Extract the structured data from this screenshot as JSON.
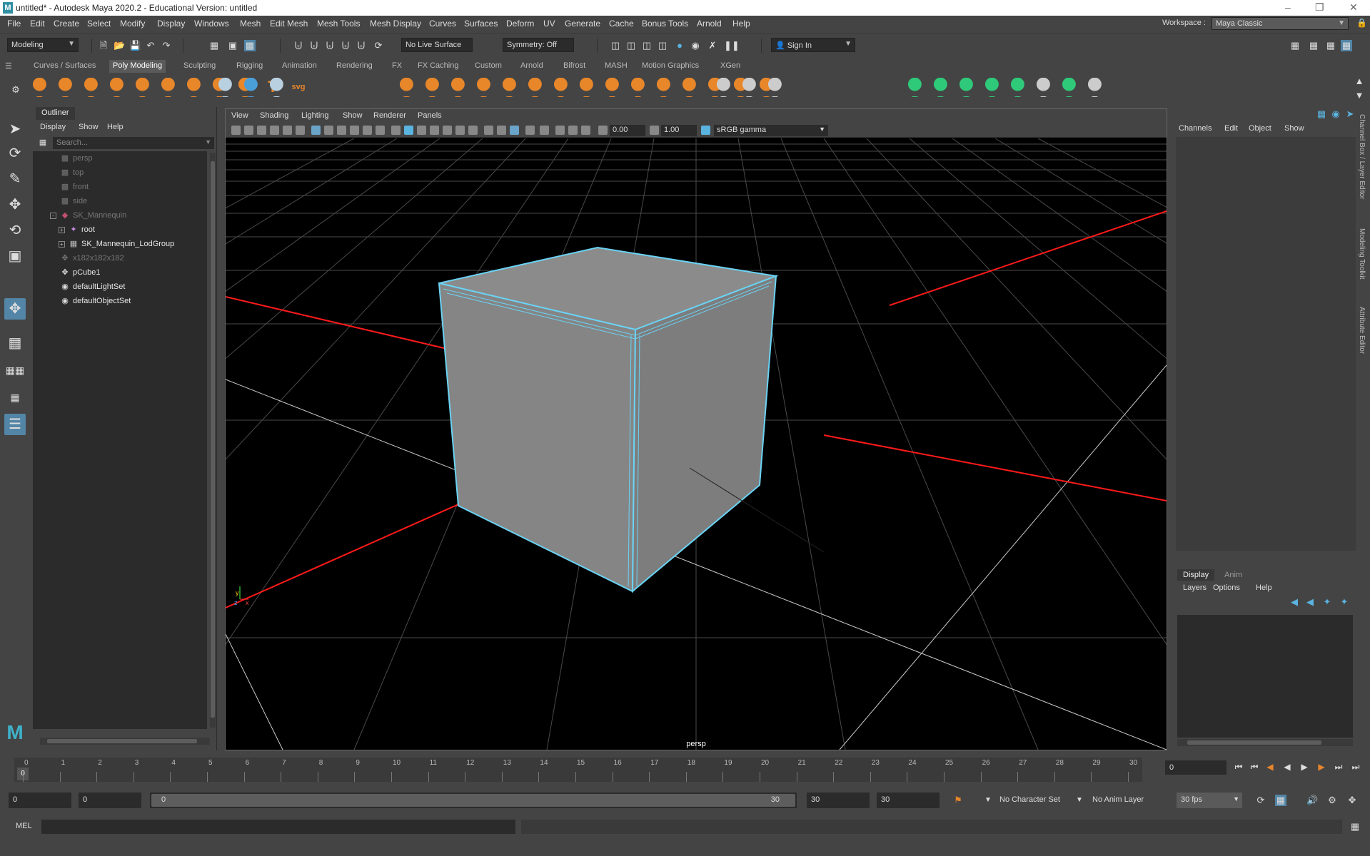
{
  "window": {
    "title": "untitled* - Autodesk Maya 2020.2 - Educational Version: untitled",
    "logo": "M"
  },
  "menubar": {
    "items": [
      "File",
      "Edit",
      "Create",
      "Select",
      "Modify",
      "Display",
      "Windows",
      "Mesh",
      "Edit Mesh",
      "Mesh Tools",
      "Mesh Display",
      "Curves",
      "Surfaces",
      "Deform",
      "UV",
      "Generate",
      "Cache",
      "Bonus Tools",
      "Arnold",
      "Help"
    ],
    "workspace_label": "Workspace :",
    "workspace_value": "Maya Classic"
  },
  "statusline": {
    "mode": "Modeling",
    "live_surface": "No Live Surface",
    "symmetry": "Symmetry: Off",
    "sign_in": "Sign In"
  },
  "shelf": {
    "tabs": [
      "Curves / Surfaces",
      "Poly Modeling",
      "Sculpting",
      "Rigging",
      "Animation",
      "Rendering",
      "FX",
      "FX Caching",
      "Custom",
      "Arnold",
      "Bifrost",
      "MASH",
      "Motion Graphics",
      "XGen"
    ],
    "active": "Poly Modeling",
    "icons": [
      {
        "name": "poly-sphere-icon",
        "color": "#e8862a"
      },
      {
        "name": "poly-cube-icon",
        "color": "#e8862a"
      },
      {
        "name": "poly-cylinder-icon",
        "color": "#e8862a"
      },
      {
        "name": "poly-cone-icon",
        "color": "#e8862a"
      },
      {
        "name": "poly-torus-icon",
        "color": "#e8862a"
      },
      {
        "name": "poly-plane-icon",
        "color": "#e8862a"
      },
      {
        "name": "poly-disc-icon",
        "color": "#e8862a"
      },
      {
        "name": "platonic-icon",
        "color": "#e8862a"
      },
      {
        "name": "super-shape-icon",
        "color": "#e8862a"
      },
      {
        "name": "type-icon",
        "color": "#e8862a",
        "glyph": "T"
      },
      {
        "name": "svg-icon",
        "color": "#e8862a",
        "glyph": "svg"
      },
      {
        "name": "combine-icon",
        "color": "#b8d0e0"
      },
      {
        "name": "separate-icon",
        "color": "#4a9fd8"
      },
      {
        "name": "smooth-icon",
        "color": "#b8d0e0"
      },
      {
        "name": "extract-icon",
        "color": "#e8862a"
      },
      {
        "name": "boolean-icon",
        "color": "#e8862a"
      },
      {
        "name": "mirror-icon",
        "color": "#e8862a"
      },
      {
        "name": "smooth-mesh-icon",
        "color": "#e8862a"
      },
      {
        "name": "reduce-icon",
        "color": "#e8862a"
      },
      {
        "name": "remesh-icon",
        "color": "#e8862a"
      },
      {
        "name": "retopo-icon",
        "color": "#e8862a"
      },
      {
        "name": "extrude-icon",
        "color": "#e8862a"
      },
      {
        "name": "bridge-icon",
        "color": "#e8862a"
      },
      {
        "name": "bevel-icon",
        "color": "#e8862a"
      },
      {
        "name": "fill-hole-icon",
        "color": "#e8862a"
      },
      {
        "name": "append-icon",
        "color": "#e8862a"
      },
      {
        "name": "wedge-icon",
        "color": "#e8862a"
      },
      {
        "name": "poke-icon",
        "color": "#e8862a"
      },
      {
        "name": "circularize-icon",
        "color": "#e8862a"
      },
      {
        "name": "multi-cut-icon",
        "color": "#cccccc"
      },
      {
        "name": "edge-loop-icon",
        "color": "#cccccc"
      },
      {
        "name": "slide-icon",
        "color": "#cccccc"
      },
      {
        "name": "uv-project-icon",
        "color": "#2fc97a"
      },
      {
        "name": "uv-camera-icon",
        "color": "#2fc97a"
      },
      {
        "name": "uv-auto-icon",
        "color": "#2fc97a"
      },
      {
        "name": "uv-cylindrical-icon",
        "color": "#2fc97a"
      },
      {
        "name": "uv-unfold-icon",
        "color": "#2fc97a"
      },
      {
        "name": "uv-layout-icon",
        "color": "#cccccc"
      },
      {
        "name": "uv-cut-icon",
        "color": "#2fc97a"
      },
      {
        "name": "uv-sew-icon",
        "color": "#cccccc"
      }
    ]
  },
  "outliner": {
    "title": "Outliner",
    "menu": [
      "Display",
      "Show",
      "Help"
    ],
    "search_placeholder": "Search...",
    "rows": [
      {
        "label": "persp",
        "icon": "camera-icon",
        "level": 1,
        "dim": true
      },
      {
        "label": "top",
        "icon": "camera-icon",
        "level": 1,
        "dim": true
      },
      {
        "label": "front",
        "icon": "camera-icon",
        "level": 1,
        "dim": true
      },
      {
        "label": "side",
        "icon": "camera-icon",
        "level": 1,
        "dim": true
      },
      {
        "label": "SK_Mannequin",
        "icon": "mesh-icon",
        "level": 1,
        "dim": true,
        "expander": "-"
      },
      {
        "label": "root",
        "icon": "joint-icon",
        "level": 2,
        "dim": false,
        "expander": "+"
      },
      {
        "label": "SK_Mannequin_LodGroup",
        "icon": "lod-icon",
        "level": 2,
        "dim": false,
        "expander": "+"
      },
      {
        "label": "x182x182x182",
        "icon": "transform-icon",
        "level": 1,
        "dim": true
      },
      {
        "label": "pCube1",
        "icon": "transform-icon",
        "level": 1,
        "dim": false
      },
      {
        "label": "defaultLightSet",
        "icon": "set-icon",
        "level": 1,
        "dim": false
      },
      {
        "label": "defaultObjectSet",
        "icon": "set-icon",
        "level": 1,
        "dim": false
      }
    ]
  },
  "viewport": {
    "menu": [
      "View",
      "Shading",
      "Lighting",
      "Show",
      "Renderer",
      "Panels"
    ],
    "exposure": "0.00",
    "gamma": "1.00",
    "color_space": "sRGB gamma",
    "camera_label": "persp",
    "axis_x": "x",
    "axis_y": "y",
    "axis_z": "z"
  },
  "channelbox": {
    "menu": [
      "Channels",
      "Edit",
      "Object",
      "Show"
    ],
    "tabs": [
      "Display",
      "Anim"
    ],
    "active_tab": "Display",
    "layer_menu": [
      "Layers",
      "Options",
      "Help"
    ]
  },
  "side_tabs": [
    "Channel Box / Layer Editor",
    "Modeling Toolkit",
    "Attribute Editor"
  ],
  "timeline": {
    "ticks": [
      0,
      1,
      2,
      3,
      4,
      5,
      6,
      7,
      8,
      9,
      10,
      11,
      12,
      13,
      14,
      15,
      16,
      17,
      18,
      19,
      20,
      21,
      22,
      23,
      24,
      25,
      26,
      27,
      28,
      29,
      30
    ],
    "current": "0",
    "current_frame_field": "0"
  },
  "range": {
    "start": "0",
    "anim_start": "0",
    "slider_start": "0",
    "slider_end": "30",
    "end": "30",
    "anim_end": "30",
    "character_set": "No Character Set",
    "anim_layer": "No Anim Layer",
    "fps": "30 fps"
  },
  "cmdline": {
    "label": "MEL"
  }
}
